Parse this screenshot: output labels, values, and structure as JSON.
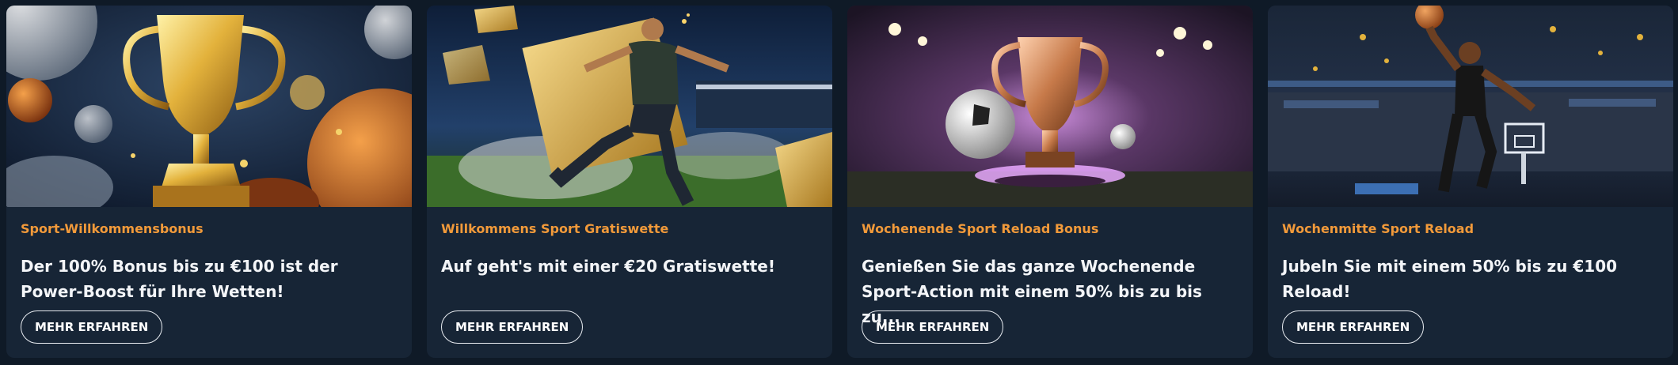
{
  "promotions": [
    {
      "category": "Sport-Willkommensbonus",
      "description": "Der 100% Bonus bis zu €100 ist der Power-Boost für Ihre Wetten!",
      "button_label": "MEHR ERFAHREN",
      "image": "golden-trophy-with-sports-balls"
    },
    {
      "category": "Willkommens Sport Gratiswette",
      "description": "Auf geht's mit einer €20 Gratiswette!",
      "button_label": "MEHR ERFAHREN",
      "image": "soccer-player-kicking-with-golden-tickets"
    },
    {
      "category": "Wochenende Sport Reload Bonus",
      "description": "Genießen Sie das ganze Wochenende Sport-Action mit einem 50% bis zu bis zu...",
      "button_label": "MEHR ERFAHREN",
      "image": "trophy-and-soccer-ball-in-stadium"
    },
    {
      "category": "Wochenmitte Sport Reload",
      "description": "Jubeln Sie mit einem 50% bis zu €100 Reload!",
      "button_label": "MEHR ERFAHREN",
      "image": "basketball-player-dunking-in-arena"
    }
  ],
  "colors": {
    "page_background": "#0f1a27",
    "card_background": "#172536",
    "category_text": "#f29a3a",
    "description_text": "#f3f5f8",
    "button_border": "#e8ecf1"
  }
}
